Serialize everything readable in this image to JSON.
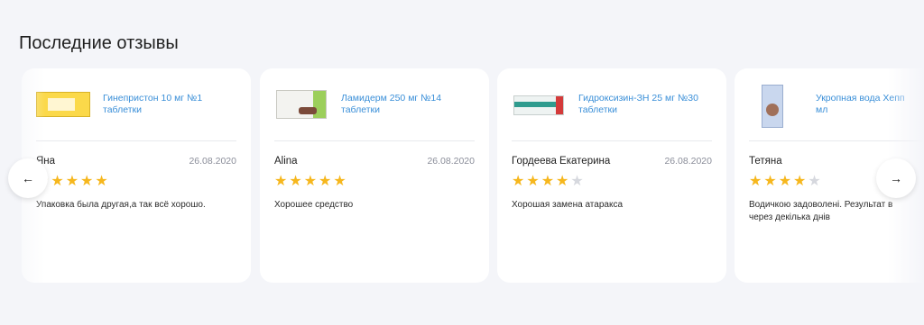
{
  "section": {
    "title": "Последние отзывы"
  },
  "nav": {
    "prev_icon": "arrow-left-icon",
    "next_icon": "arrow-right-icon",
    "prev_glyph": "←",
    "next_glyph": "→"
  },
  "colors": {
    "star_on": "#f6b71d",
    "star_off": "#d6d8de",
    "link": "#3a8fd8",
    "card_bg": "#ffffff",
    "page_bg": "#f4f5f9"
  },
  "reviews": [
    {
      "product": {
        "line1": "Гинепристон 10 мг №1",
        "line2": "таблетки"
      },
      "author": "Яна",
      "date": "26.08.2020",
      "rating": 5,
      "text": "Упаковка была другая,а так всё хорошо."
    },
    {
      "product": {
        "line1": "Ламидерм 250 мг №14",
        "line2": "таблетки"
      },
      "author": "Alina",
      "date": "26.08.2020",
      "rating": 5,
      "text": "Хорошее средство"
    },
    {
      "product": {
        "line1": "Гидроксизин-ЗН 25 мг №30",
        "line2": "таблетки"
      },
      "author": "Гордеева Екатерина",
      "date": "26.08.2020",
      "rating": 4,
      "text": "Хорошая замена атаракса"
    },
    {
      "product": {
        "line1": "Укропная вода Хепп",
        "line2": "мл"
      },
      "author": "Тетяна",
      "date": "",
      "rating": 4,
      "text": "Водичкою задоволені. Результат в",
      "text2": "через декілька днів"
    }
  ]
}
